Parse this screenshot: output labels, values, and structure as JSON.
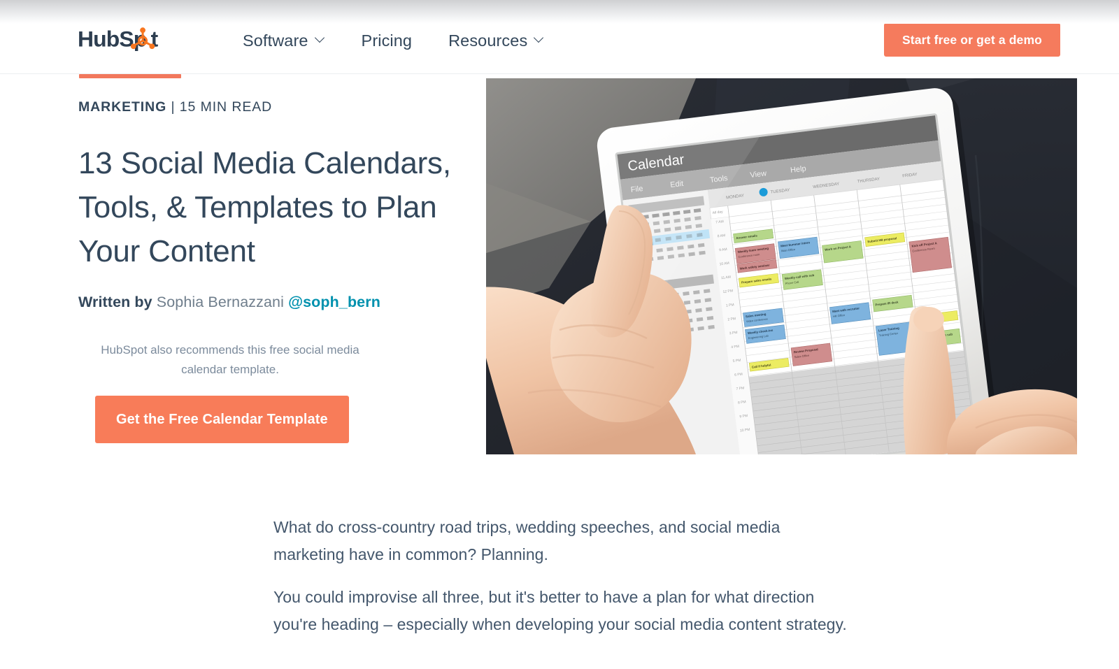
{
  "header": {
    "logo_name": "HubSpot",
    "nav": [
      {
        "label": "Software",
        "has_dropdown": true
      },
      {
        "label": "Pricing",
        "has_dropdown": false
      },
      {
        "label": "Resources",
        "has_dropdown": true
      }
    ],
    "cta_label": "Start free or get a demo"
  },
  "hero": {
    "kicker_category": "MARKETING",
    "kicker_rest": " | 15 MIN READ",
    "title": "13 Social Media Calendars, Tools, & Templates to Plan Your Content",
    "byline_label": "Written by",
    "byline_name": " Sophia Bernazzani ",
    "byline_handle": "@soph_bern",
    "recommend_text": "HubSpot also recommends this free social media calendar template.",
    "cta_label": "Get the Free Calendar Template",
    "image_alt": "Hands holding a white tablet displaying a weekly calendar app, resting on dark denim jeans"
  },
  "hero_image_content": {
    "app_title": "Calendar",
    "menu": [
      "File",
      "Edit",
      "Tools",
      "View",
      "Help"
    ],
    "day_columns": [
      "MONDAY",
      "TUESDAY",
      "WEDNESDAY",
      "THURSDAY",
      "FRIDAY"
    ],
    "selected_day": "TUESDAY",
    "time_labels": [
      "All day",
      "7 AM",
      "8 AM",
      "9 AM",
      "10 AM",
      "11 AM",
      "12 PM",
      "1 PM",
      "2 PM",
      "3 PM",
      "4 PM",
      "5 PM",
      "6 PM",
      "7 PM",
      "8 PM",
      "9 PM",
      "10 PM"
    ],
    "events": [
      {
        "title": "Answer emails",
        "sub": "",
        "color": "green",
        "day": 0
      },
      {
        "title": "Weekly team meeting",
        "sub": "Conference room",
        "color": "red",
        "day": 0
      },
      {
        "title": "Work safety seminar",
        "sub": "",
        "color": "red",
        "day": 0
      },
      {
        "title": "Prepare sales emails",
        "sub": "",
        "color": "yellow",
        "day": 0
      },
      {
        "title": "Sales meeting",
        "sub": "Video conference",
        "color": "blue",
        "day": 0
      },
      {
        "title": "Weekly check-ins",
        "sub": "Engineering Lab",
        "color": "blue",
        "day": 0
      },
      {
        "title": "Call if helpful",
        "sub": "",
        "color": "yellow",
        "day": 0
      },
      {
        "title": "Meet Summer intern",
        "sub": "Main Office",
        "color": "blue",
        "day": 1
      },
      {
        "title": "Weekly call with sub",
        "sub": "Phone Call",
        "color": "green",
        "day": 1
      },
      {
        "title": "Review Proposal",
        "sub": "Sales Office",
        "color": "red",
        "day": 1
      },
      {
        "title": "Work on Project A",
        "sub": "",
        "color": "green",
        "day": 2
      },
      {
        "title": "Meet with recruiter",
        "sub": "HR Office",
        "color": "blue",
        "day": 2
      },
      {
        "title": "Submit HR proposal",
        "sub": "",
        "color": "yellow",
        "day": 3
      },
      {
        "title": "Prepare IR deck",
        "sub": "",
        "color": "green",
        "day": 3
      },
      {
        "title": "Laser Training",
        "sub": "Training Center",
        "color": "blue",
        "day": 3
      },
      {
        "title": "Kick off Project A",
        "sub": "Conference Room",
        "color": "red",
        "day": 4
      },
      {
        "title": "Send Proposal",
        "sub": "",
        "color": "yellow",
        "day": 4
      },
      {
        "title": "Weekly call with sub",
        "sub": "Phone Call",
        "color": "green",
        "day": 4
      }
    ]
  },
  "article": {
    "paragraphs": [
      "What do cross-country road trips, wedding speeches, and social media marketing have in common? Planning.",
      "You could improvise all three, but it's better to have a plan for what direction you're heading – especially when developing your social media content strategy."
    ]
  },
  "colors": {
    "brand_orange": "#f2785c",
    "cta_orange": "#f87c59",
    "navy": "#33475b",
    "link_teal": "#0091ae",
    "body_text": "#44576c",
    "muted_text": "#7c8b9c"
  }
}
